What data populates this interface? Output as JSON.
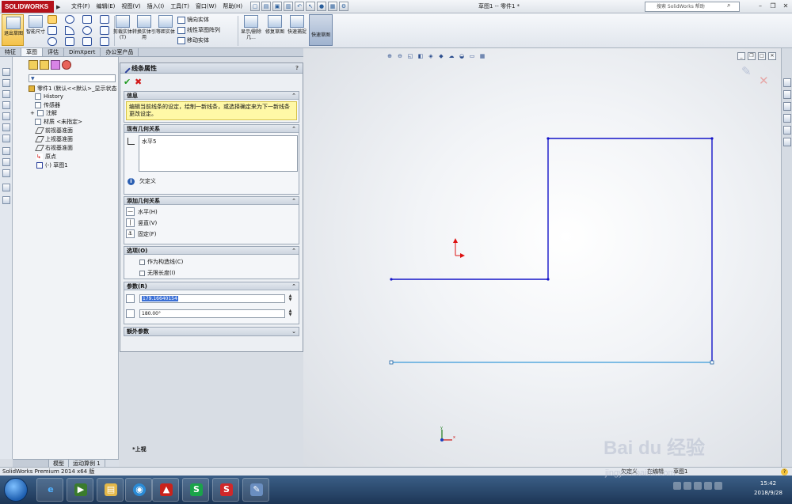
{
  "app": {
    "logo": "SOLIDWORKS",
    "doc_title": "草图1 -- 零件1 *",
    "search_placeholder": "搜索 SolidWorks 帮助"
  },
  "menu": [
    "文件(F)",
    "编辑(E)",
    "视图(V)",
    "插入(I)",
    "工具(T)",
    "窗口(W)",
    "帮助(H)"
  ],
  "ribbon": {
    "exit_sketch": "退出草图",
    "smart_dim": "智能尺寸",
    "trim": "剪裁实体(T)",
    "convert": "转换实体引用",
    "offset": "等距实体",
    "mirror": "镜向实体",
    "linear_pattern": "线性草图阵列",
    "move": "移动实体",
    "show_delete": "显示/删除几...",
    "repair": "修复草图",
    "quick_snap": "快速捕捉",
    "quick_sketch": "快速草图"
  },
  "cm_tabs": [
    "特征",
    "草图",
    "评估",
    "DimXpert",
    "办公室产品"
  ],
  "tree": {
    "part": "零件1 (默认<<默认>_显示状态",
    "items": [
      "History",
      "传感器",
      "注解",
      "材质 <未指定>",
      "前视基准面",
      "上视基准面",
      "右视基准面",
      "原点",
      "(-) 草图1"
    ]
  },
  "bottom_tabs": [
    "模型",
    "运动算例 1"
  ],
  "pm": {
    "title": "线条属性",
    "info_header": "信息",
    "info_text": "编辑当前线条的设定，绘制一新线条，或选择确定来为下一新线条更改设定。",
    "existing_header": "现有几何关系",
    "existing_rel": "水平5",
    "status": "欠定义",
    "add_header": "添加几何关系",
    "add_horizontal": "水平(H)",
    "add_vertical": "竖直(V)",
    "add_fix": "固定(F)",
    "options_header": "选项(O)",
    "opt_construction": "作为构造线(C)",
    "opt_infinite": "无限长度(I)",
    "params_header": "参数(R)",
    "length": "179.16640154",
    "angle": "180.00°",
    "extra_header": "额外参数"
  },
  "view_label": "*上视",
  "status": {
    "left": "SolidWorks Premium 2014 x64 版",
    "state": "欠定义",
    "mode": "在编辑",
    "sketch": "草图1"
  },
  "clock": {
    "time": "15:42",
    "date": "2018/9/28"
  },
  "watermark": "Bai du 经验",
  "watermark_url": "jingyan.baidu.com",
  "colors": {
    "sketch_line": "#1414c8",
    "selected_line": "#3a9ad9",
    "brand": "#b5121b"
  }
}
